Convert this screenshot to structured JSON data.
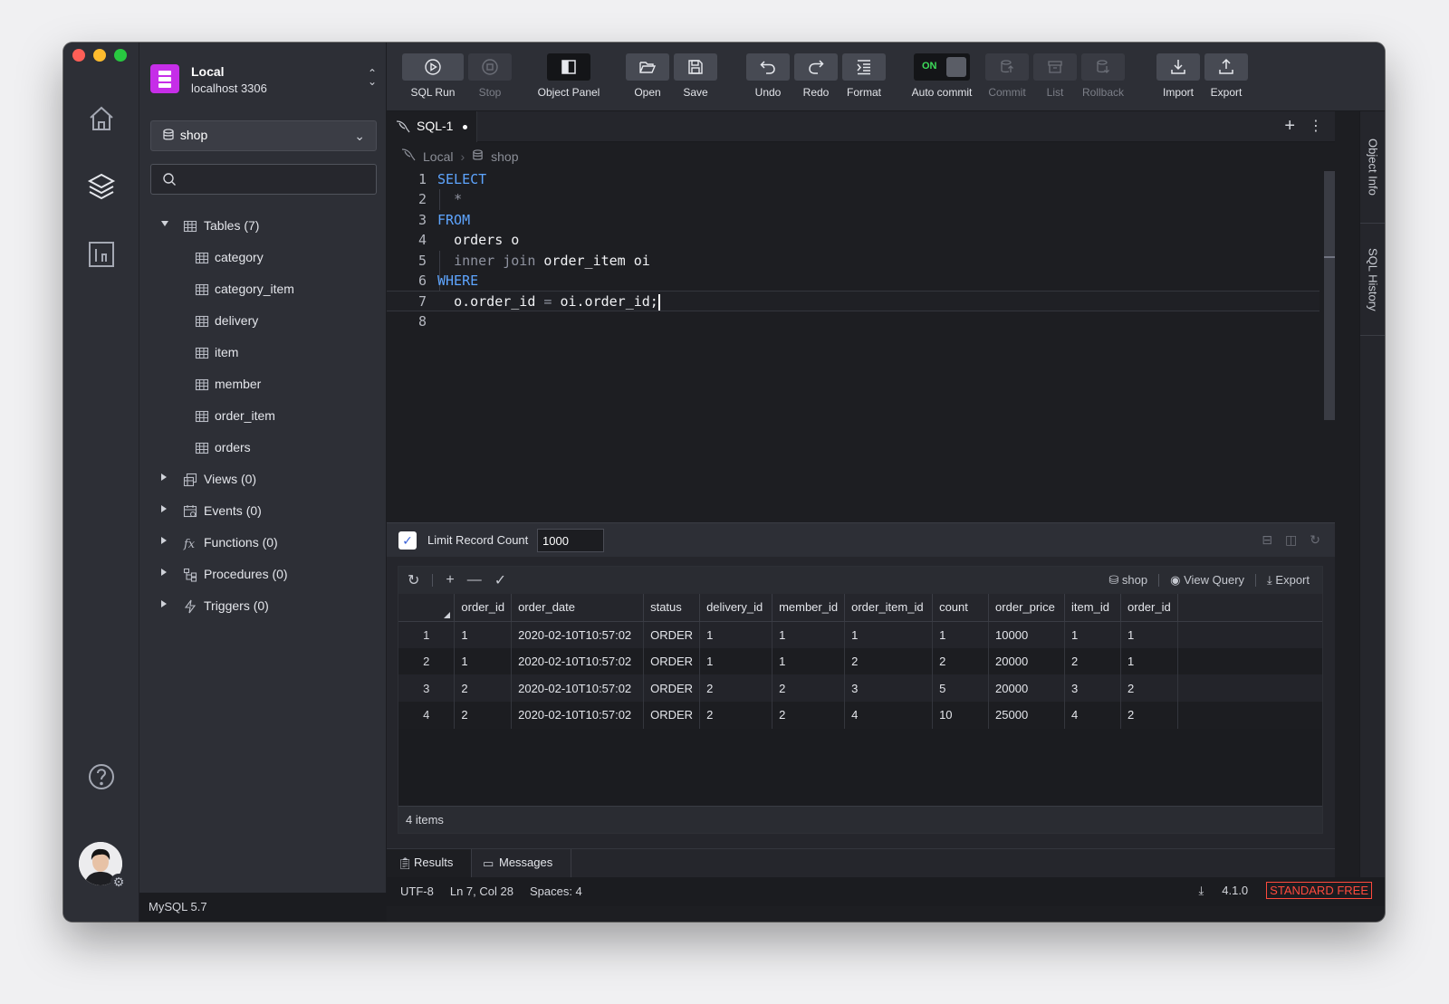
{
  "connection": {
    "name": "Local",
    "host": "localhost",
    "port": "3306"
  },
  "database_select": {
    "value": "shop"
  },
  "search": {
    "placeholder": ""
  },
  "tree": {
    "tables_label": "Tables (7)",
    "tables": [
      "category",
      "category_item",
      "delivery",
      "item",
      "member",
      "order_item",
      "orders"
    ],
    "groups": [
      {
        "label": "Views (0)",
        "icon": "view-icon"
      },
      {
        "label": "Events (0)",
        "icon": "event-icon"
      },
      {
        "label": "Functions (0)",
        "icon": "function-icon"
      },
      {
        "label": "Procedures (0)",
        "icon": "procedure-icon"
      },
      {
        "label": "Triggers (0)",
        "icon": "trigger-icon"
      }
    ]
  },
  "sidebar_status": "MySQL 5.7",
  "toolbar": {
    "sql_run": "SQL Run",
    "stop": "Stop",
    "object_panel": "Object Panel",
    "open": "Open",
    "save": "Save",
    "undo": "Undo",
    "redo": "Redo",
    "format": "Format",
    "auto_commit": "Auto commit",
    "auto_commit_state": "ON",
    "commit": "Commit",
    "list": "List",
    "rollback": "Rollback",
    "import": "Import",
    "export": "Export"
  },
  "editor_tab": {
    "label": "SQL-1"
  },
  "breadcrumb": {
    "connection": "Local",
    "database": "shop"
  },
  "code_lines": [
    {
      "n": "1"
    },
    {
      "n": "2"
    },
    {
      "n": "3"
    },
    {
      "n": "4"
    },
    {
      "n": "5"
    },
    {
      "n": "6"
    },
    {
      "n": "7"
    },
    {
      "n": "8"
    }
  ],
  "code": {
    "l1": "SELECT",
    "l2": "*",
    "l3": "FROM",
    "l4": "orders o",
    "l5_kw": "inner join",
    "l5_rest": " order_item oi",
    "l6": "WHERE",
    "l7_a": "o.order_id",
    "l7_op": " = ",
    "l7_b": "oi.order_id;"
  },
  "right_tabs": {
    "object_info": "Object Info",
    "sql_history": "SQL History"
  },
  "limit": {
    "label": "Limit Record Count",
    "value": "1000",
    "checked": true
  },
  "results_toolbar": {
    "schema": "shop",
    "view_query": "View Query",
    "export": "Export"
  },
  "columns": [
    "order_id",
    "order_date",
    "status",
    "delivery_id",
    "member_id",
    "order_item_id",
    "count",
    "order_price",
    "item_id",
    "order_id"
  ],
  "rows": [
    [
      "1",
      "1",
      "2020-02-10T10:57:02",
      "ORDER",
      "1",
      "1",
      "1",
      "1",
      "10000",
      "1",
      "1"
    ],
    [
      "2",
      "1",
      "2020-02-10T10:57:02",
      "ORDER",
      "1",
      "1",
      "2",
      "2",
      "20000",
      "2",
      "1"
    ],
    [
      "3",
      "2",
      "2020-02-10T10:57:02",
      "ORDER",
      "2",
      "2",
      "3",
      "5",
      "20000",
      "3",
      "2"
    ],
    [
      "4",
      "2",
      "2020-02-10T10:57:02",
      "ORDER",
      "2",
      "2",
      "4",
      "10",
      "25000",
      "4",
      "2"
    ]
  ],
  "results_footer": "4 items",
  "bottom_tabs": {
    "results": "Results",
    "messages": "Messages"
  },
  "status": {
    "encoding": "UTF-8",
    "position": "Ln 7, Col 28",
    "spaces": "Spaces: 4",
    "version": "4.1.0",
    "edition": "STANDARD FREE"
  }
}
